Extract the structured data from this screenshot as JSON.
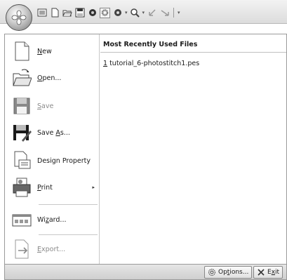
{
  "quick_access": {
    "tools": [
      "view-icon",
      "new-icon",
      "open-icon",
      "save-icon",
      "circle-icon",
      "gear-icon",
      "dropdown-circle-icon",
      "magnifier-icon",
      "undo-icon",
      "redo-icon"
    ],
    "customize": "▾"
  },
  "menu": {
    "items": [
      {
        "key": "new",
        "label": "New",
        "mnemonic": "N",
        "rest": "ew",
        "icon": "new-document-icon",
        "enabled": true
      },
      {
        "key": "open",
        "label": "Open...",
        "mnemonic": "O",
        "rest": "pen...",
        "icon": "open-folder-icon",
        "enabled": true
      },
      {
        "key": "save",
        "label": "Save",
        "mnemonic": "S",
        "rest": "ave",
        "icon": "save-icon",
        "enabled": false
      },
      {
        "key": "saveas",
        "label": "Save As...",
        "pre": "Save ",
        "mnemonic": "A",
        "rest": "s...",
        "icon": "save-as-icon",
        "enabled": true
      },
      {
        "key": "design",
        "label": "Design Property",
        "icon": "design-property-icon",
        "enabled": true
      },
      {
        "key": "print",
        "label": "Print",
        "mnemonic": "P",
        "rest": "rint",
        "icon": "printer-icon",
        "enabled": true,
        "submenu": "▸"
      },
      {
        "key": "wizard",
        "label": "Wizard...",
        "pre": "Wi",
        "mnemonic": "z",
        "rest": "ard...",
        "icon": "wizard-icon",
        "enabled": true
      },
      {
        "key": "export",
        "label": "Export...",
        "mnemonic": "E",
        "rest": "xport...",
        "icon": "export-icon",
        "enabled": false
      }
    ]
  },
  "mru": {
    "header": "Most Recently Used Files",
    "files": [
      {
        "index": "1",
        "name": " tutorial_6-photostitch1.pes"
      }
    ]
  },
  "bottom": {
    "options": {
      "pre": "Op",
      "mnemonic": "t",
      "rest": "ions..."
    },
    "exit": {
      "pre": "E",
      "mnemonic": "x",
      "rest": "it"
    }
  }
}
